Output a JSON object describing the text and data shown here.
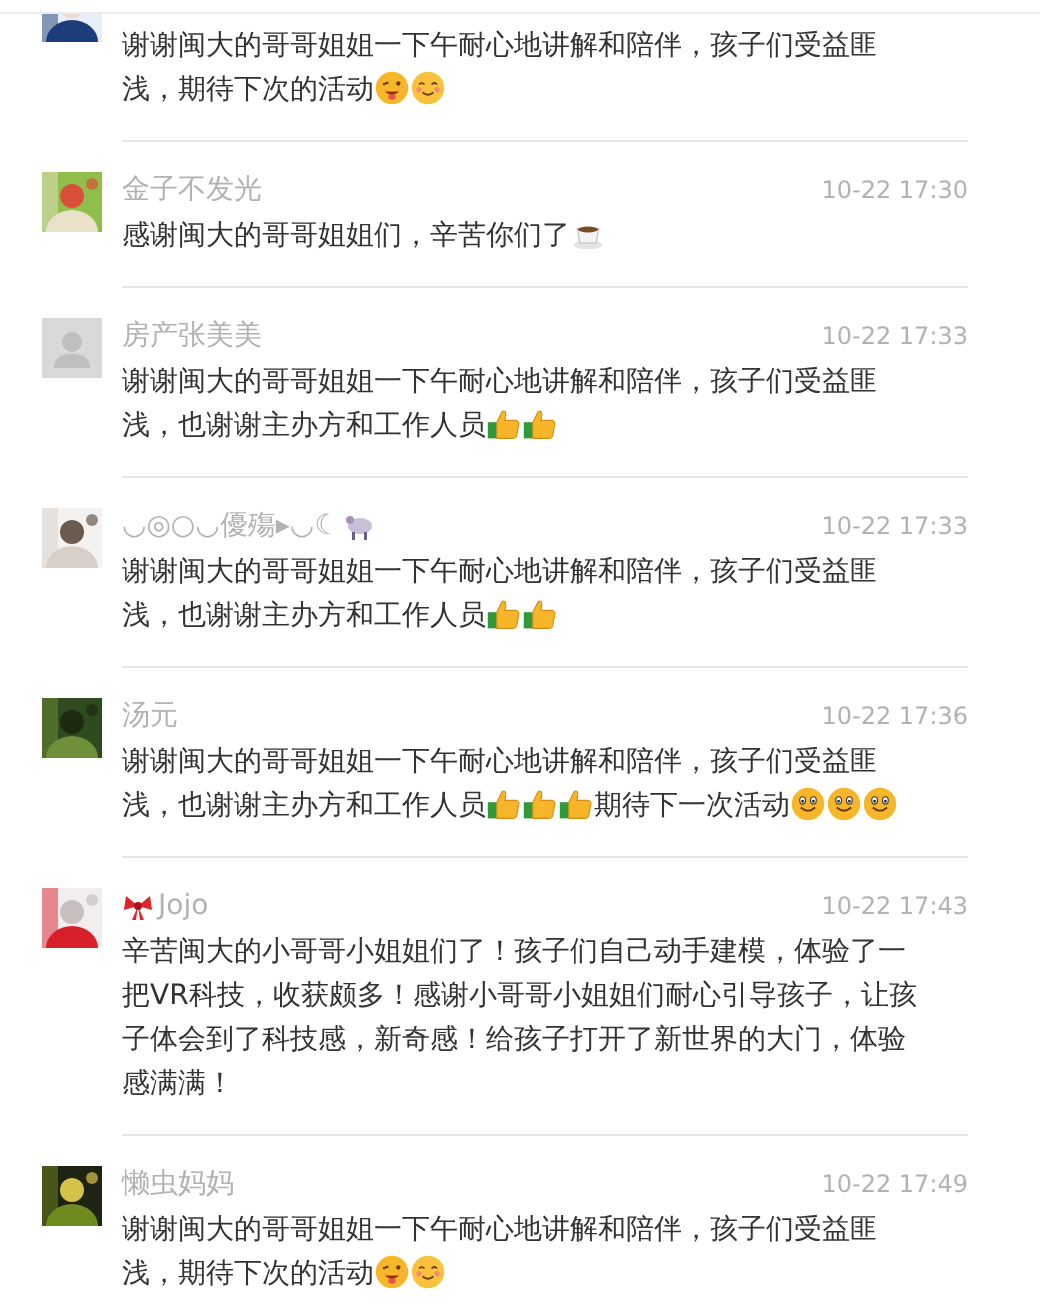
{
  "comments": [
    {
      "avatar": {
        "kind": "picture"
      },
      "lines": [
        [
          {
            "kind": "text",
            "text": "谢谢闽大的哥哥姐姐一下午耐心地讲解和陪伴，孩子们受益匪"
          }
        ],
        [
          {
            "kind": "text",
            "text": "浅，期待下次的活动"
          },
          {
            "kind": "wink"
          },
          {
            "kind": "smile"
          }
        ]
      ]
    },
    {
      "avatar": {
        "kind": "picture"
      },
      "name": "金子不发光",
      "time": "10-22 17:30",
      "lines": [
        [
          {
            "kind": "text",
            "text": "感谢闽大的哥哥姐姐们，辛苦你们了"
          },
          {
            "kind": "coffee"
          }
        ]
      ]
    },
    {
      "avatar": {
        "kind": "default"
      },
      "name": "房产张美美",
      "time": "10-22 17:33",
      "lines": [
        [
          {
            "kind": "text",
            "text": "谢谢闽大的哥哥姐姐一下午耐心地讲解和陪伴，孩子们受益匪"
          }
        ],
        [
          {
            "kind": "text",
            "text": "浅，也谢谢主办方和工作人员"
          },
          {
            "kind": "thumbs-up"
          },
          {
            "kind": "thumbs-up"
          }
        ]
      ]
    },
    {
      "avatar": {
        "kind": "picture"
      },
      "name": "◡◎○◡優殤▸◡☾",
      "name_icons": [
        {
          "kind": "sheep"
        }
      ],
      "time": "10-22 17:33",
      "lines": [
        [
          {
            "kind": "text",
            "text": "谢谢闽大的哥哥姐姐一下午耐心地讲解和陪伴，孩子们受益匪"
          }
        ],
        [
          {
            "kind": "text",
            "text": "浅，也谢谢主办方和工作人员"
          },
          {
            "kind": "thumbs-up"
          },
          {
            "kind": "thumbs-up"
          }
        ]
      ]
    },
    {
      "avatar": {
        "kind": "picture"
      },
      "name": "汤元",
      "time": "10-22 17:36",
      "lines": [
        [
          {
            "kind": "text",
            "text": "谢谢闽大的哥哥姐姐一下午耐心地讲解和陪伴，孩子们受益匪"
          }
        ],
        [
          {
            "kind": "text",
            "text": "浅，也谢谢主办方和工作人员"
          },
          {
            "kind": "thumbs-up"
          },
          {
            "kind": "thumbs-up"
          },
          {
            "kind": "thumbs-up"
          },
          {
            "kind": "text",
            "text": "期待下一次活动"
          },
          {
            "kind": "grin"
          },
          {
            "kind": "grin"
          },
          {
            "kind": "grin"
          }
        ]
      ]
    },
    {
      "avatar": {
        "kind": "picture"
      },
      "name": "Jojo",
      "prefix_icons": [
        {
          "kind": "ribbon"
        }
      ],
      "time": "10-22 17:43",
      "lines": [
        [
          {
            "kind": "text",
            "text": "辛苦闽大的小哥哥小姐姐们了！孩子们自己动手建模，体验了一"
          }
        ],
        [
          {
            "kind": "text",
            "text": "把VR科技，收获颇多！感谢小哥哥小姐姐们耐心引导孩子，让孩"
          }
        ],
        [
          {
            "kind": "text",
            "text": "子体会到了科技感，新奇感！给孩子打开了新世界的大门，体验"
          }
        ],
        [
          {
            "kind": "text",
            "text": "感满满！"
          }
        ]
      ]
    },
    {
      "avatar": {
        "kind": "picture"
      },
      "name": "懒虫妈妈",
      "time": "10-22 17:49",
      "lines": [
        [
          {
            "kind": "text",
            "text": "谢谢闽大的哥哥姐姐一下午耐心地讲解和陪伴，孩子们受益匪"
          }
        ],
        [
          {
            "kind": "text",
            "text": "浅，期待下次的活动"
          },
          {
            "kind": "wink"
          },
          {
            "kind": "smile"
          }
        ]
      ]
    }
  ]
}
